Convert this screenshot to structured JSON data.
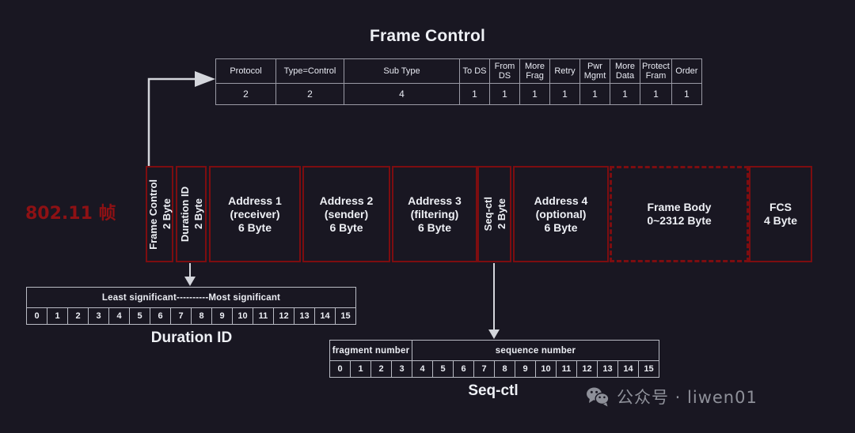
{
  "background_color": "#191722",
  "accent_red": "#7d0d10",
  "label_red": "#8e1114",
  "text_color": "#eef0f5",
  "border_gray": "#9a9aa5",
  "frame_control": {
    "title": "Frame Control",
    "fields": [
      {
        "name": "Protocol",
        "bits": "2"
      },
      {
        "name": "Type=Control",
        "bits": "2"
      },
      {
        "name": "Sub Type",
        "bits": "4"
      },
      {
        "name": "To DS",
        "bits": "1"
      },
      {
        "name": "From DS",
        "bits": "1"
      },
      {
        "name": "More Frag",
        "bits": "1"
      },
      {
        "name": "Retry",
        "bits": "1"
      },
      {
        "name": "Pwr Mgmt",
        "bits": "1"
      },
      {
        "name": "More Data",
        "bits": "1"
      },
      {
        "name": "Protect Fram",
        "bits": "1"
      },
      {
        "name": "Order",
        "bits": "1"
      }
    ]
  },
  "frame": {
    "label": "802.11 帧",
    "fields": [
      {
        "name": "Frame Control",
        "size": "2 Byte",
        "note": "",
        "orient": "vertical",
        "style": "solid"
      },
      {
        "name": "Duration ID",
        "size": "2 Byte",
        "note": "",
        "orient": "vertical",
        "style": "solid"
      },
      {
        "name": "Address 1",
        "size": "6 Byte",
        "note": "(receiver)",
        "orient": "horizontal",
        "style": "solid"
      },
      {
        "name": "Address 2",
        "size": "6 Byte",
        "note": "(sender)",
        "orient": "horizontal",
        "style": "solid"
      },
      {
        "name": "Address 3",
        "size": "6 Byte",
        "note": "(filtering)",
        "orient": "horizontal",
        "style": "solid"
      },
      {
        "name": "Seq-ctl",
        "size": "2 Byte",
        "note": "",
        "orient": "vertical",
        "style": "solid"
      },
      {
        "name": "Address 4",
        "size": "6 Byte",
        "note": "(optional)",
        "orient": "horizontal",
        "style": "solid"
      },
      {
        "name": "Frame Body",
        "size": "0~2312 Byte",
        "note": "",
        "orient": "horizontal",
        "style": "dashed"
      },
      {
        "name": "FCS",
        "size": "4 Byte",
        "note": "",
        "orient": "horizontal",
        "style": "solid"
      }
    ]
  },
  "duration_id": {
    "caption": "Duration ID",
    "header": "Least significant----------Most significant",
    "bits": [
      "0",
      "1",
      "2",
      "3",
      "4",
      "5",
      "6",
      "7",
      "8",
      "9",
      "10",
      "11",
      "12",
      "13",
      "14",
      "15"
    ]
  },
  "seq_ctl": {
    "caption": "Seq-ctl",
    "groups": [
      {
        "label": "fragment number",
        "bits": [
          "0",
          "1",
          "2",
          "3"
        ]
      },
      {
        "label": "sequence number",
        "bits": [
          "4",
          "5",
          "6",
          "7",
          "8",
          "9",
          "10",
          "11",
          "12",
          "13",
          "14",
          "15"
        ]
      }
    ]
  },
  "watermark": {
    "icon": "wechat-icon",
    "text": "公众号 · liwen01"
  }
}
